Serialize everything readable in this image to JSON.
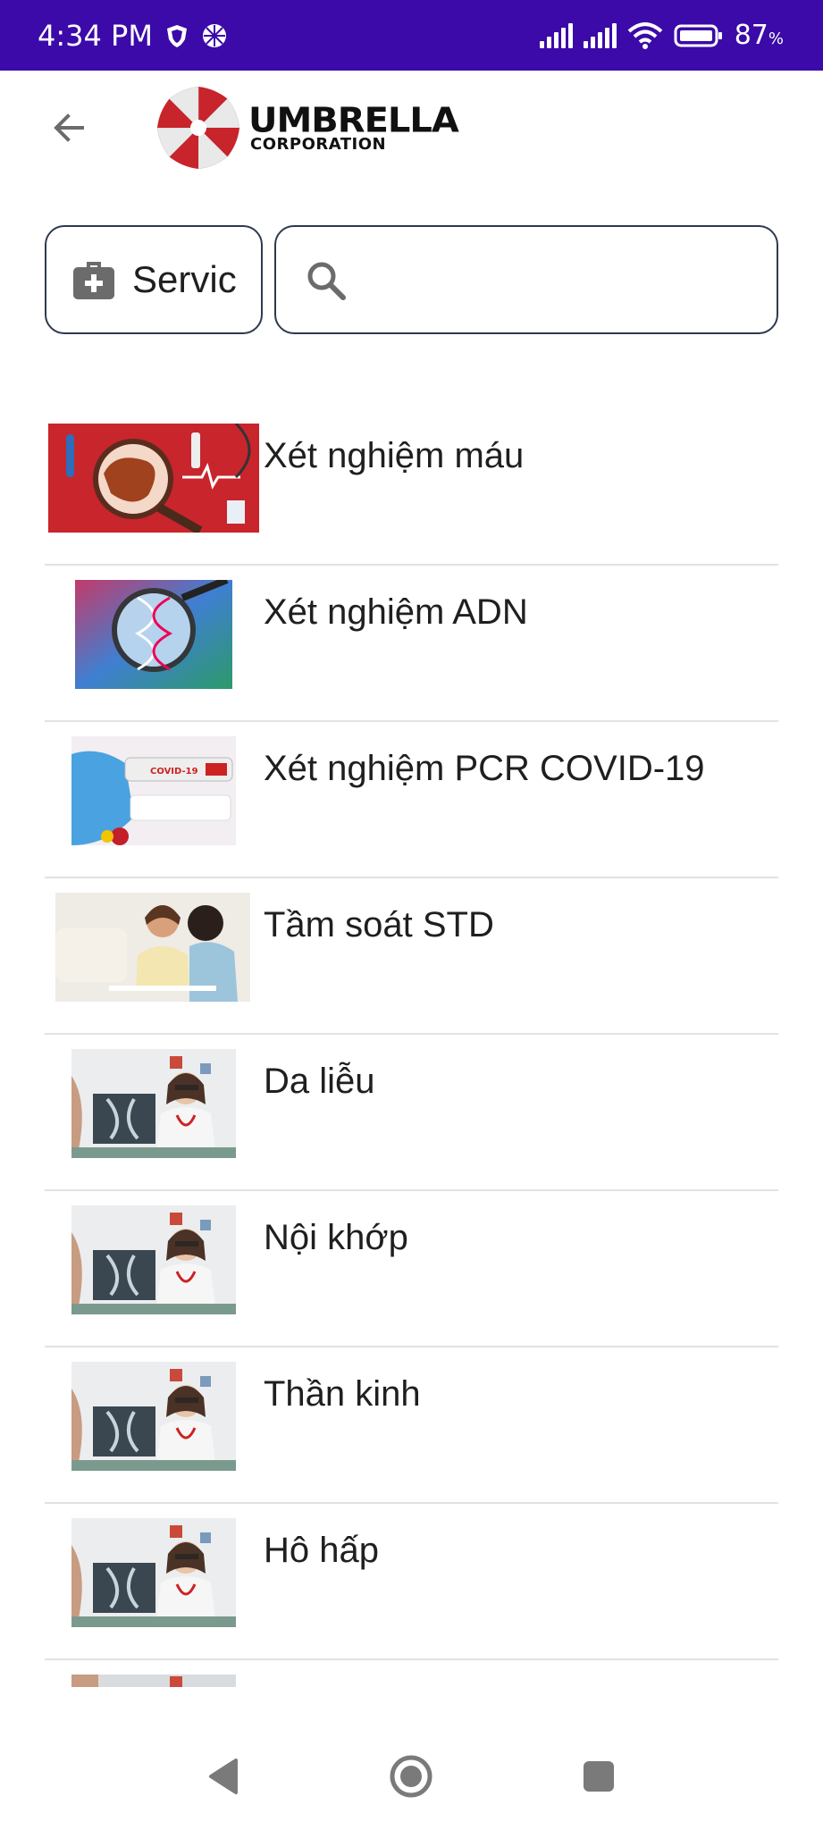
{
  "status_bar": {
    "time": "4:34 PM",
    "battery_level": "87",
    "battery_unit": "%",
    "icons": [
      "shield-icon",
      "flower-icon",
      "signal-icon",
      "signal-icon",
      "wifi-icon",
      "battery-icon"
    ]
  },
  "app_bar": {
    "back_icon": "arrow-left-icon",
    "logo": {
      "name": "UMBRELLA",
      "subtitle": "CORPORATION"
    }
  },
  "filter": {
    "service_label": "Servic",
    "service_icon": "medical-kit-icon",
    "search_placeholder": "",
    "search_value": "",
    "search_icon": "search-icon"
  },
  "services": [
    {
      "label": "Xét nghiệm máu"
    },
    {
      "label": "Xét nghiệm ADN"
    },
    {
      "label": "Xét nghiệm PCR COVID-19"
    },
    {
      "label": "Tầm soát STD"
    },
    {
      "label": "Da liễu"
    },
    {
      "label": "Nội khớp"
    },
    {
      "label": "Thần kinh"
    },
    {
      "label": "Hô hấp"
    },
    {
      "label": ""
    }
  ],
  "nav_bar": {
    "icons": [
      "nav-back-icon",
      "nav-home-icon",
      "nav-recents-icon"
    ]
  },
  "colors": {
    "status_bar": "#3b0aa8",
    "border": "#2d3a4e",
    "divider": "#e2e2e2",
    "logo_red": "#c8242b"
  }
}
